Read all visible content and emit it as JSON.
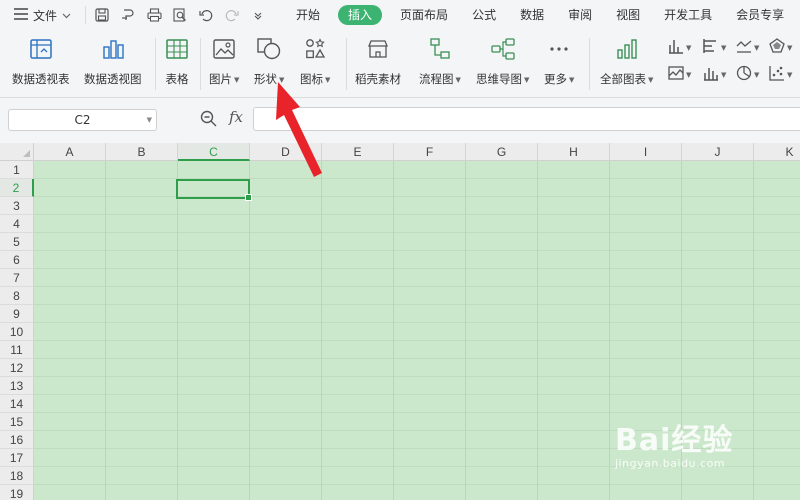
{
  "menubar": {
    "file_label": "文件",
    "tabs": [
      {
        "label": "开始",
        "active": false
      },
      {
        "label": "插入",
        "active": true
      },
      {
        "label": "页面布局",
        "active": false
      },
      {
        "label": "公式",
        "active": false
      },
      {
        "label": "数据",
        "active": false
      },
      {
        "label": "审阅",
        "active": false
      },
      {
        "label": "视图",
        "active": false
      },
      {
        "label": "开发工具",
        "active": false
      },
      {
        "label": "会员专享",
        "active": false
      }
    ]
  },
  "ribbon": {
    "pivot_table": "数据透视表",
    "pivot_chart": "数据透视图",
    "table": "表格",
    "picture": "图片",
    "shape": "形状",
    "icon": "图标",
    "docer_material": "稻壳素材",
    "flowchart": "流程图",
    "mindmap": "思维导图",
    "more": "更多",
    "all_charts": "全部图表"
  },
  "formula_bar": {
    "name_box": "C2",
    "fx_label": "fx",
    "formula_value": ""
  },
  "sheet": {
    "columns": [
      "A",
      "B",
      "C",
      "D",
      "E",
      "F",
      "G",
      "H",
      "I",
      "J",
      "K"
    ],
    "rows": [
      "1",
      "2",
      "3",
      "4",
      "5",
      "6",
      "7",
      "8",
      "9",
      "10",
      "11",
      "12",
      "13",
      "14",
      "15",
      "16",
      "17",
      "18",
      "19"
    ],
    "selected_column": "C",
    "selected_row": "2",
    "cell_color": "#cce8cc"
  },
  "watermark": {
    "brand": "Bai经验",
    "url": "jingyan.baidu.com"
  },
  "colors": {
    "accent": "#3cb371",
    "arrow": "#e8242a"
  }
}
